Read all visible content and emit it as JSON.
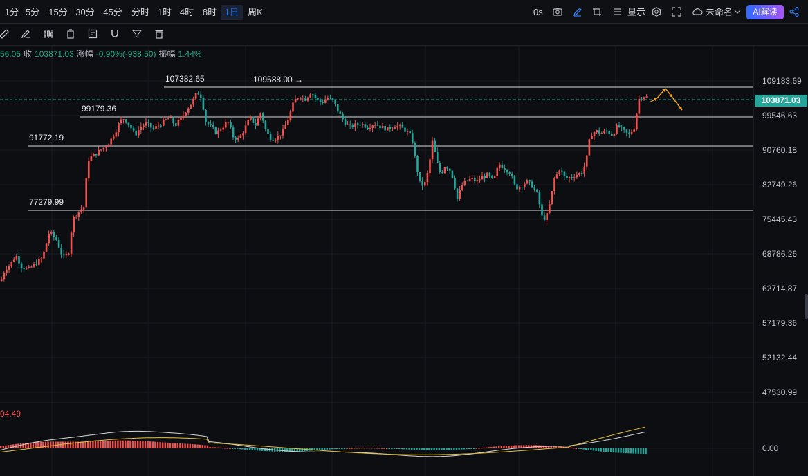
{
  "toolbar": {
    "timeframes": [
      "1分",
      "5分",
      "15分",
      "30分",
      "45分",
      "分时",
      "1时",
      "4时",
      "8时",
      "1日",
      "周K"
    ],
    "active_timeframe": "1日",
    "countdown": "0s",
    "display_label": "显示",
    "layout_name": "未命名",
    "ai_button": "AI解读"
  },
  "icons": {
    "camera": "camera-icon",
    "pencil": "pencil-icon",
    "crop": "crop-icon",
    "list": "list-icon",
    "settings": "gear-icon",
    "fullscreen": "fullscreen-icon",
    "cloud": "cloud-icon",
    "chevron": "chevron-down-icon",
    "share": "share-icon"
  },
  "drawing_tools": [
    "ruler-icon",
    "brush-icon",
    "candlestick-icon",
    "copy-icon",
    "note-icon",
    "magnet-icon",
    "filter-icon",
    "trash-icon"
  ],
  "ohlc": {
    "open_partial": "56.05",
    "close_label": "收",
    "close": "103871.03",
    "change_label": "涨幅",
    "change": "-0.90%(-938.50)",
    "amp_label": "振幅",
    "amplitude": "1.44%"
  },
  "colors": {
    "up": "#ef5350",
    "down": "#26a69a",
    "arrow": "#f5a623",
    "macd_dif": "#d7d7d7",
    "macd_dea": "#e6c43a"
  },
  "price_axis": {
    "labels": [
      "109183.69",
      "99546.63",
      "90760.18",
      "82749.26",
      "75445.43",
      "68786.26",
      "62714.87",
      "57179.36",
      "52132.44",
      "47530.99",
      "0.00"
    ],
    "current_price": "103871.03"
  },
  "macd": {
    "value_label": "04.49"
  },
  "chart_data": {
    "type": "candlestick",
    "scale": "log",
    "ylim": [
      46000,
      116000
    ],
    "levels": [
      {
        "price": 107382.65,
        "label": "107382.65",
        "type": "line"
      },
      {
        "price": 99179.36,
        "label": "99179.36",
        "type": "line"
      },
      {
        "price": 91772.19,
        "label": "91772.19",
        "type": "line"
      },
      {
        "price": 77279.99,
        "label": "77279.99",
        "type": "line"
      },
      {
        "price": 109588.0,
        "label": "109588.00",
        "type": "marker"
      }
    ],
    "close_path": [
      [
        0,
        64000
      ],
      [
        6,
        66000
      ],
      [
        14,
        67000
      ],
      [
        22,
        68500
      ],
      [
        30,
        66500
      ],
      [
        40,
        66000
      ],
      [
        50,
        67000
      ],
      [
        60,
        68000
      ],
      [
        70,
        73000
      ],
      [
        80,
        71500
      ],
      [
        90,
        68000
      ],
      [
        98,
        69000
      ],
      [
        104,
        75500
      ],
      [
        112,
        77000
      ],
      [
        120,
        78000
      ],
      [
        126,
        88500
      ],
      [
        134,
        89500
      ],
      [
        142,
        90500
      ],
      [
        150,
        91500
      ],
      [
        158,
        93000
      ],
      [
        166,
        95500
      ],
      [
        172,
        98000
      ],
      [
        178,
        98800
      ],
      [
        186,
        97000
      ],
      [
        194,
        94500
      ],
      [
        202,
        96500
      ],
      [
        210,
        97500
      ],
      [
        220,
        96000
      ],
      [
        228,
        97000
      ],
      [
        236,
        98000
      ],
      [
        244,
        99000
      ],
      [
        252,
        97000
      ],
      [
        260,
        98500
      ],
      [
        268,
        101000
      ],
      [
        276,
        103000
      ],
      [
        284,
        106000
      ],
      [
        290,
        104500
      ],
      [
        296,
        98000
      ],
      [
        304,
        96500
      ],
      [
        312,
        95000
      ],
      [
        320,
        96500
      ],
      [
        328,
        98000
      ],
      [
        336,
        94000
      ],
      [
        344,
        93500
      ],
      [
        352,
        96000
      ],
      [
        360,
        99000
      ],
      [
        368,
        97000
      ],
      [
        376,
        100500
      ],
      [
        384,
        95000
      ],
      [
        392,
        93500
      ],
      [
        400,
        94000
      ],
      [
        408,
        95500
      ],
      [
        416,
        99000
      ],
      [
        424,
        103500
      ],
      [
        432,
        105000
      ],
      [
        440,
        104000
      ],
      [
        448,
        106000
      ],
      [
        456,
        104000
      ],
      [
        464,
        103000
      ],
      [
        472,
        104500
      ],
      [
        480,
        103500
      ],
      [
        488,
        100500
      ],
      [
        496,
        98000
      ],
      [
        504,
        96500
      ],
      [
        512,
        97000
      ],
      [
        520,
        97500
      ],
      [
        530,
        96500
      ],
      [
        540,
        97500
      ],
      [
        550,
        96500
      ],
      [
        560,
        96000
      ],
      [
        570,
        97000
      ],
      [
        578,
        96500
      ],
      [
        586,
        95500
      ],
      [
        594,
        94000
      ],
      [
        600,
        87500
      ],
      [
        606,
        83000
      ],
      [
        612,
        82500
      ],
      [
        618,
        86000
      ],
      [
        624,
        93000
      ],
      [
        630,
        88000
      ],
      [
        636,
        85000
      ],
      [
        642,
        87000
      ],
      [
        648,
        86500
      ],
      [
        654,
        84000
      ],
      [
        660,
        79500
      ],
      [
        666,
        82500
      ],
      [
        672,
        83500
      ],
      [
        680,
        84000
      ],
      [
        688,
        83500
      ],
      [
        696,
        84500
      ],
      [
        704,
        85000
      ],
      [
        712,
        83500
      ],
      [
        720,
        87500
      ],
      [
        728,
        86500
      ],
      [
        736,
        85500
      ],
      [
        744,
        82000
      ],
      [
        752,
        82500
      ],
      [
        760,
        83500
      ],
      [
        768,
        82500
      ],
      [
        776,
        80500
      ],
      [
        782,
        76000
      ],
      [
        788,
        75500
      ],
      [
        794,
        79000
      ],
      [
        800,
        84000
      ],
      [
        808,
        86500
      ],
      [
        816,
        84000
      ],
      [
        824,
        84500
      ],
      [
        832,
        85000
      ],
      [
        840,
        85500
      ],
      [
        846,
        88000
      ],
      [
        852,
        94500
      ],
      [
        860,
        95500
      ],
      [
        868,
        95000
      ],
      [
        876,
        95500
      ],
      [
        884,
        94500
      ],
      [
        892,
        97000
      ],
      [
        900,
        95500
      ],
      [
        908,
        94500
      ],
      [
        916,
        96500
      ],
      [
        922,
        104000
      ],
      [
        928,
        105000
      ],
      [
        934,
        104500
      ]
    ],
    "forecast_path": [
      [
        940,
        103200
      ],
      [
        950,
        104300
      ],
      [
        962,
        107000
      ],
      [
        972,
        104500
      ],
      [
        986,
        101000
      ]
    ],
    "macd": {
      "histogram_sign": "oscillates around zero, positive at latest bars"
    }
  }
}
